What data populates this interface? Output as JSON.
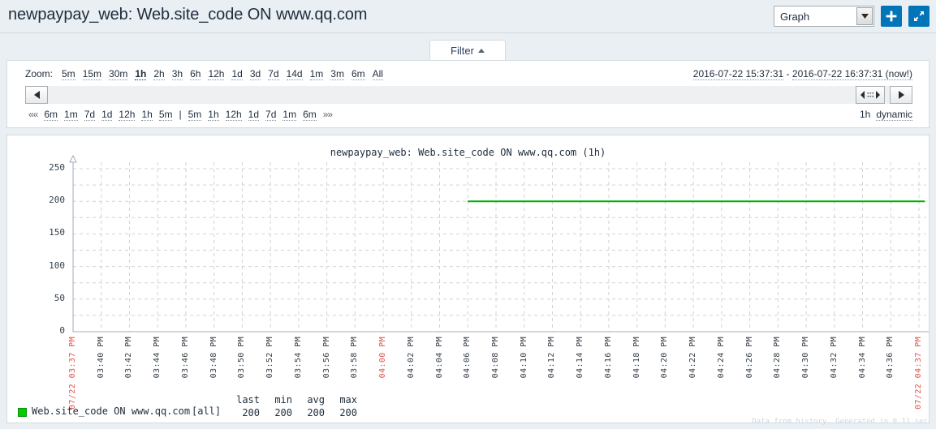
{
  "header": {
    "title": "newpaypay_web: Web.site_code ON www.qq.com",
    "view_select": {
      "value": "Graph",
      "icon": "chevron-down-icon"
    },
    "add_button": {
      "icon": "plus-icon",
      "label": "+"
    },
    "fullscreen_button": {
      "icon": "expand-diagonal-icon",
      "label": "⤢"
    }
  },
  "tabs": {
    "filter": {
      "label": "Filter",
      "icon": "triangle-up-icon"
    }
  },
  "filter": {
    "zoom_label": "Zoom:",
    "zoom_links": [
      {
        "label": "5m",
        "active": false
      },
      {
        "label": "15m",
        "active": false
      },
      {
        "label": "30m",
        "active": false
      },
      {
        "label": "1h",
        "active": true
      },
      {
        "label": "2h",
        "active": false
      },
      {
        "label": "3h",
        "active": false
      },
      {
        "label": "6h",
        "active": false
      },
      {
        "label": "12h",
        "active": false
      },
      {
        "label": "1d",
        "active": false
      },
      {
        "label": "3d",
        "active": false
      },
      {
        "label": "7d",
        "active": false
      },
      {
        "label": "14d",
        "active": false
      },
      {
        "label": "1m",
        "active": false
      },
      {
        "label": "3m",
        "active": false
      },
      {
        "label": "6m",
        "active": false
      },
      {
        "label": "All",
        "active": false
      }
    ],
    "range_from": "2016-07-22 15:37:31",
    "range_separator": " - ",
    "range_to": "2016-07-22 16:37:31 (now!)",
    "scroll_left_icon": "triangle-left-icon",
    "grip_icon": "resize-grip-icon",
    "scroll_right_icon": "triangle-right-icon",
    "step_first": "««",
    "step_last": "»»",
    "step_back": [
      "6m",
      "1m",
      "7d",
      "1d",
      "12h",
      "1h",
      "5m"
    ],
    "step_divider": "|",
    "step_fwd": [
      "5m",
      "1h",
      "12h",
      "1d",
      "7d",
      "1m",
      "6m"
    ],
    "period_value": "1h",
    "period_mode": "dynamic"
  },
  "chart_data": {
    "type": "line",
    "title": "newpaypay_web: Web.site_code ON www.qq.com  (1h)",
    "xlabel": "",
    "ylabel": "",
    "ylim": [
      0,
      250
    ],
    "yticks": [
      0,
      50,
      100,
      150,
      200,
      250
    ],
    "grid": true,
    "legend_position": "bottom",
    "xticks": [
      "07/22 03:37 PM",
      "03:40 PM",
      "03:42 PM",
      "03:44 PM",
      "03:46 PM",
      "03:48 PM",
      "03:50 PM",
      "03:52 PM",
      "03:54 PM",
      "03:56 PM",
      "03:58 PM",
      "04:00 PM",
      "04:02 PM",
      "04:04 PM",
      "04:06 PM",
      "04:08 PM",
      "04:10 PM",
      "04:12 PM",
      "04:14 PM",
      "04:16 PM",
      "04:18 PM",
      "04:20 PM",
      "04:22 PM",
      "04:24 PM",
      "04:26 PM",
      "04:28 PM",
      "04:30 PM",
      "04:32 PM",
      "04:34 PM",
      "04:36 PM",
      "07/22 04:37 PM"
    ],
    "xtick_highlight": [
      "07/22 03:37 PM",
      "04:00 PM",
      "07/22 04:37 PM"
    ],
    "series": [
      {
        "name": "Web.site_code ON www.qq.com",
        "color": "#00b000",
        "value": 200,
        "x_start_label": "04:06 PM",
        "x_end_label": "07/22 04:37 PM",
        "values": [
          200,
          200,
          200,
          200,
          200,
          200,
          200,
          200,
          200,
          200,
          200,
          200,
          200,
          200,
          200,
          200
        ]
      }
    ]
  },
  "legend": {
    "swatch_color": "#00cc00",
    "item_name": "Web.site_code ON www.qq.com",
    "aggregate": "[all]",
    "columns": [
      {
        "header": "last",
        "value": "200"
      },
      {
        "header": "min",
        "value": "200"
      },
      {
        "header": "avg",
        "value": "200"
      },
      {
        "header": "max",
        "value": "200"
      }
    ]
  },
  "footer": {
    "note": "Data from history. Generated in 0.11 sec"
  }
}
